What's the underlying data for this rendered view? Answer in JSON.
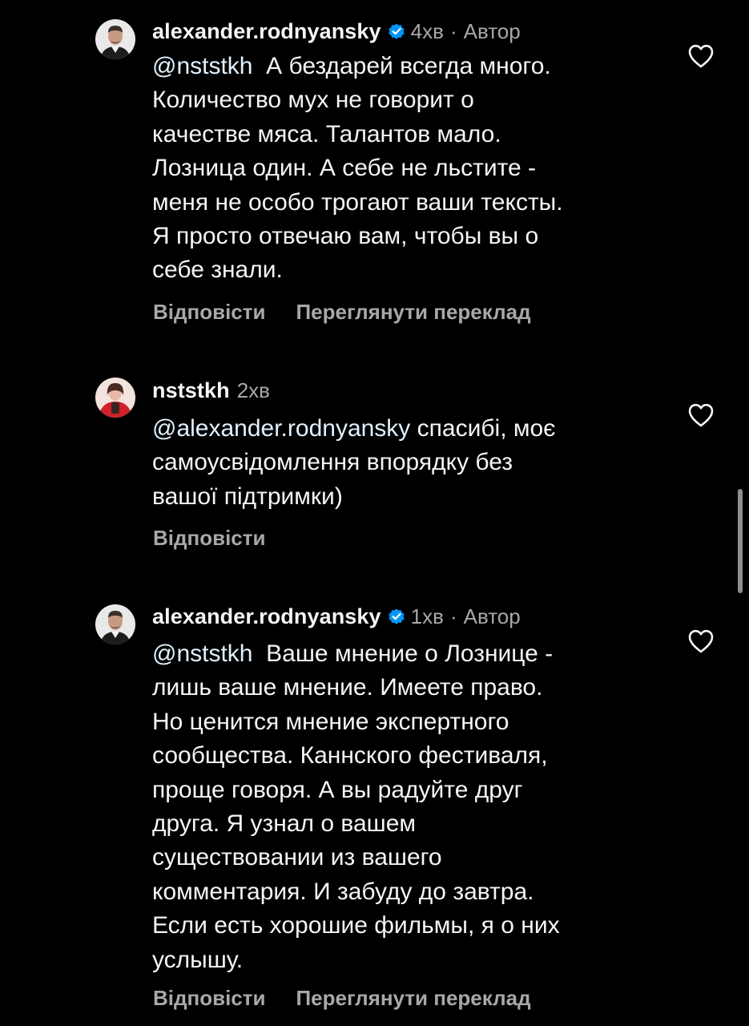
{
  "colors": {
    "background": "#000000",
    "primary_text": "#f5f5f5",
    "secondary_text": "#a8a8a8",
    "verified_badge": "#0095f6"
  },
  "comments": [
    {
      "username": "alexander.rodnyansky",
      "verified": true,
      "time": "4хв",
      "separator": "·",
      "author_tag": "Автор",
      "mention": "@nststkh",
      "text": "А бездарей всегда много.\nКоличество мух не говорит о\nкачестве мяса. Талантов мало.\nЛозница один. А себе не льстите -\nменя не особо трогают ваши тексты.\nЯ просто отвечаю вам, чтобы вы о\nсебе знали.",
      "reply_label": "Відповісти",
      "translate_label": "Переглянути переклад",
      "avatar_icon": "man-portrait-avatar",
      "like_icon": "heart-outline-icon"
    },
    {
      "username": "nststkh",
      "verified": false,
      "time": "2хв",
      "mention": "@alexander.rodnyansky",
      "text": "спасибі, моє\nсамоусвідомлення впорядку без\nвашої підтримки)",
      "reply_label": "Відповісти",
      "avatar_icon": "woman-red-outfit-avatar",
      "like_icon": "heart-outline-icon"
    },
    {
      "username": "alexander.rodnyansky",
      "verified": true,
      "time": "1хв",
      "separator": "·",
      "author_tag": "Автор",
      "mention": "@nststkh",
      "text": "Ваше мнение о Лознице -\nлишь ваше мнение. Имеете право.\nНо ценится мнение экспертного\nсообщества. Каннского фестиваля,\nпроще говоря. А вы радуйте друг\nдруга. Я узнал о вашем\nсуществовании из вашего\nкомментария. И забуду до завтра.\nЕсли есть хорошие фильмы, я о них\nуслышу.",
      "reply_label": "Відповісти",
      "translate_label": "Переглянути переклад",
      "avatar_icon": "man-portrait-avatar",
      "like_icon": "heart-outline-icon"
    }
  ]
}
